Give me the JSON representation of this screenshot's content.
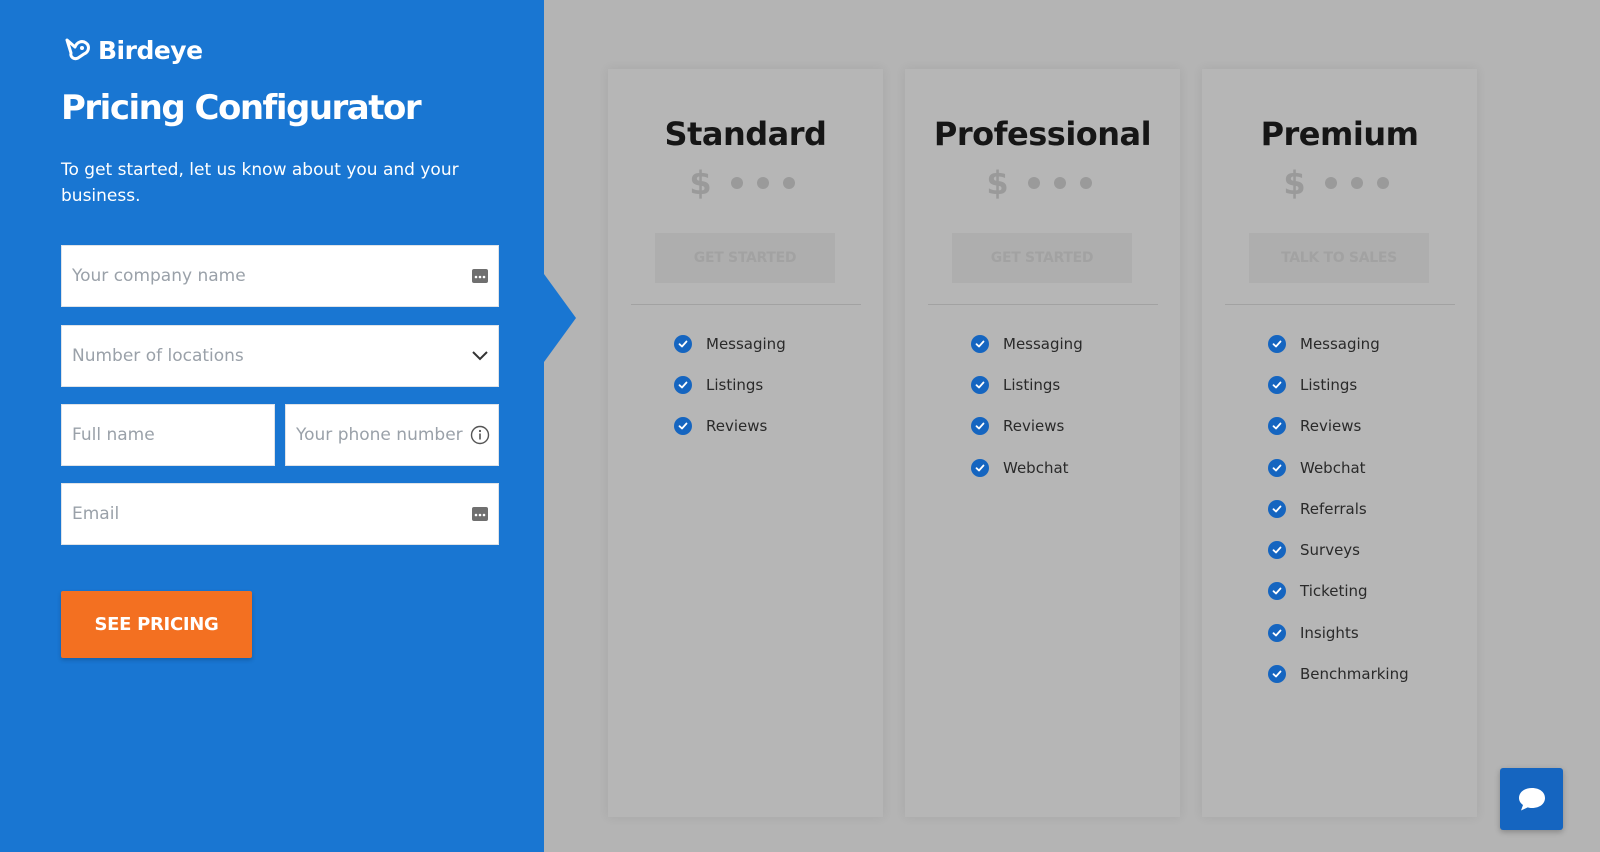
{
  "brand": {
    "name": "Birdeye"
  },
  "form": {
    "title": "Pricing Configurator",
    "subtitle": "To get started, let us know about you and your business.",
    "company_placeholder": "Your company name",
    "locations_placeholder": "Number of locations",
    "name_placeholder": "Full name",
    "phone_placeholder": "Your phone number",
    "email_placeholder": "Email",
    "submit_label": "SEE PRICING"
  },
  "plans": [
    {
      "name": "Standard",
      "price_symbol": "$",
      "button_label": "GET STARTED",
      "features": [
        "Messaging",
        "Listings",
        "Reviews"
      ]
    },
    {
      "name": "Professional",
      "price_symbol": "$",
      "button_label": "GET STARTED",
      "features": [
        "Messaging",
        "Listings",
        "Reviews",
        "Webchat"
      ]
    },
    {
      "name": "Premium",
      "price_symbol": "$",
      "button_label": "TALK TO SALES",
      "features": [
        "Messaging",
        "Listings",
        "Reviews",
        "Webchat",
        "Referrals",
        "Surveys",
        "Ticketing",
        "Insights",
        "Benchmarking"
      ]
    }
  ],
  "colors": {
    "brand_blue": "#1976d2",
    "cta_orange": "#f37021",
    "check_blue": "#1565c0",
    "overlay_gray": "#b4b4b4"
  },
  "icons": {
    "logo": "birdeye-logo-icon",
    "field_autofill": "autofill-icon",
    "dropdown": "chevron-down-icon",
    "info": "info-icon",
    "check": "check-circle-icon",
    "chat": "chat-bubble-icon"
  }
}
